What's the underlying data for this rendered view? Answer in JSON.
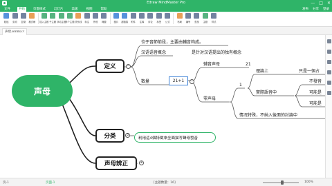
{
  "window": {
    "title": "Edraw MindMaster Pro",
    "controls": [
      "—",
      "□",
      "✕"
    ]
  },
  "menu": {
    "items": [
      "文件",
      "开始",
      "页面样式",
      "幻灯片",
      "高级",
      "视图",
      "帮助"
    ],
    "active_index": 1,
    "right": [
      "发布",
      "分享",
      "登录"
    ]
  },
  "toolbar": {
    "tools": [
      {
        "label": "粘贴",
        "icon": "paste-icon",
        "color": "b"
      },
      {
        "label": "剪切",
        "icon": "cut-icon",
        "color": ""
      },
      {
        "label": "复制",
        "icon": "copy-icon",
        "color": ""
      },
      {
        "label": "格式刷",
        "icon": "format-painter-icon",
        "color": "o"
      },
      {
        "label": "插入主题",
        "icon": "insert-topic-icon",
        "color": "g"
      },
      {
        "label": "子主题",
        "icon": "subtopic-icon",
        "color": "g"
      },
      {
        "label": "浮动主题",
        "icon": "floating-topic-icon",
        "color": "g"
      },
      {
        "label": "多个主题",
        "icon": "multiple-topics-icon",
        "color": "g"
      },
      {
        "label": "关系线",
        "icon": "relationship-icon",
        "color": "o"
      },
      {
        "label": "标注",
        "icon": "callout-icon",
        "color": ""
      },
      {
        "label": "外框",
        "icon": "boundary-icon",
        "color": ""
      },
      {
        "label": "概要",
        "icon": "summary-icon",
        "color": ""
      },
      {
        "label": "图片",
        "icon": "image-icon",
        "color": "b"
      },
      {
        "label": "超链接",
        "icon": "hyperlink-icon",
        "color": "b"
      },
      {
        "label": "附件",
        "icon": "attachment-icon",
        "color": ""
      },
      {
        "label": "注释",
        "icon": "note-icon",
        "color": ""
      },
      {
        "label": "评论",
        "icon": "comment-icon",
        "color": ""
      },
      {
        "label": "标签",
        "icon": "tag-icon",
        "color": ""
      },
      {
        "label": "公式",
        "icon": "formula-icon",
        "color": ""
      },
      {
        "label": "布局",
        "icon": "layout-icon",
        "color": "o"
      },
      {
        "label": "编号",
        "icon": "numbering-icon",
        "color": ""
      },
      {
        "label": "查找",
        "icon": "find-icon",
        "color": ""
      },
      {
        "label": "主题",
        "icon": "theme-icon",
        "color": "g"
      },
      {
        "label": "样式",
        "icon": "style-icon",
        "color": ""
      }
    ]
  },
  "tabs": [
    {
      "label": "声母.emmx"
    }
  ],
  "mindmap": {
    "root": "声母",
    "topic1": "定义",
    "topic2": "分类",
    "topic3": "声母辨正",
    "def_line1": "位于音節前段，主要由輔音构成。",
    "def_line2_a": "汉语语音概念",
    "def_line2_b": "是针对汉语提出的独有概念",
    "count_label": "数量",
    "count_value": "21+1",
    "consonant_label": "辅音声母",
    "consonant_value": "21",
    "zero_label": "零声母",
    "one": "1",
    "theory": "理論上",
    "theory_val": "只是一個占",
    "actual": "實際語音中",
    "actual_1": "不發音",
    "actual_2": "可能是",
    "actual_3": "可能是",
    "special": "情况特殊，不納入後面的討論中",
    "classify_tip": "利用這4個特徵來全面描写聲母發音",
    "collapse_signs": [
      "−",
      "3",
      "+"
    ]
  },
  "rail": {
    "icons": [
      "format-icon",
      "clip-art-icon",
      "outline-icon",
      "marker-icon",
      "history-icon",
      "task-icon"
    ]
  },
  "status": {
    "page": "页-1",
    "page_name": "页面-1",
    "topic_count": "[主题数量：16]",
    "zoom": "100%"
  },
  "colors": {
    "brand": "#2fb468",
    "selection": "#3a7fd6"
  }
}
